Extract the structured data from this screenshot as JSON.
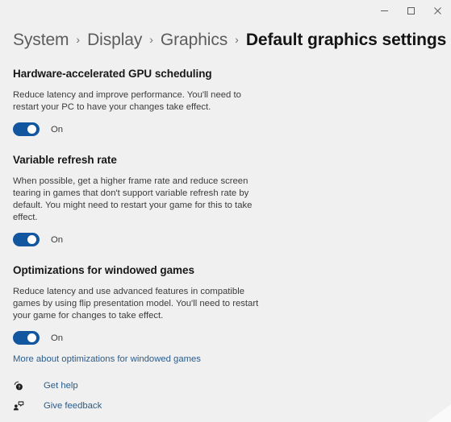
{
  "window": {
    "controls": [
      {
        "name": "minimize-button",
        "icon": "minimize-icon",
        "label": "Minimize"
      },
      {
        "name": "maximize-button",
        "icon": "maximize-icon",
        "label": "Maximize"
      },
      {
        "name": "close-button",
        "icon": "close-icon",
        "label": "Close"
      }
    ]
  },
  "breadcrumb": {
    "separator": "›",
    "items": [
      {
        "label": "System",
        "current": false
      },
      {
        "label": "Display",
        "current": false
      },
      {
        "label": "Graphics",
        "current": false
      },
      {
        "label": "Default graphics settings",
        "current": true
      }
    ]
  },
  "sections": [
    {
      "title": "Hardware-accelerated GPU scheduling",
      "description": "Reduce latency and improve performance. You'll need to restart your PC to have your changes take effect.",
      "toggle": {
        "state": "On",
        "checked": true
      }
    },
    {
      "title": "Variable refresh rate",
      "description": "When possible, get a higher frame rate and reduce screen tearing in games that don't support variable refresh rate by default. You might need to restart your game for this to take effect.",
      "toggle": {
        "state": "On",
        "checked": true
      }
    },
    {
      "title": "Optimizations for windowed games",
      "description": "Reduce latency and use advanced features in compatible games by using flip presentation model. You'll need to restart your game for changes to take effect.",
      "toggle": {
        "state": "On",
        "checked": true
      },
      "link": "More about optimizations for windowed games"
    }
  ],
  "footer": {
    "links": [
      {
        "label": "Get help",
        "icon": "help-icon"
      },
      {
        "label": "Give feedback",
        "icon": "feedback-icon"
      }
    ]
  },
  "colors": {
    "background": "#f0f0f0",
    "accent": "#1256a0",
    "link": "#2b5c8a",
    "heading": "#171717",
    "body_text": "#3c3c3c"
  }
}
